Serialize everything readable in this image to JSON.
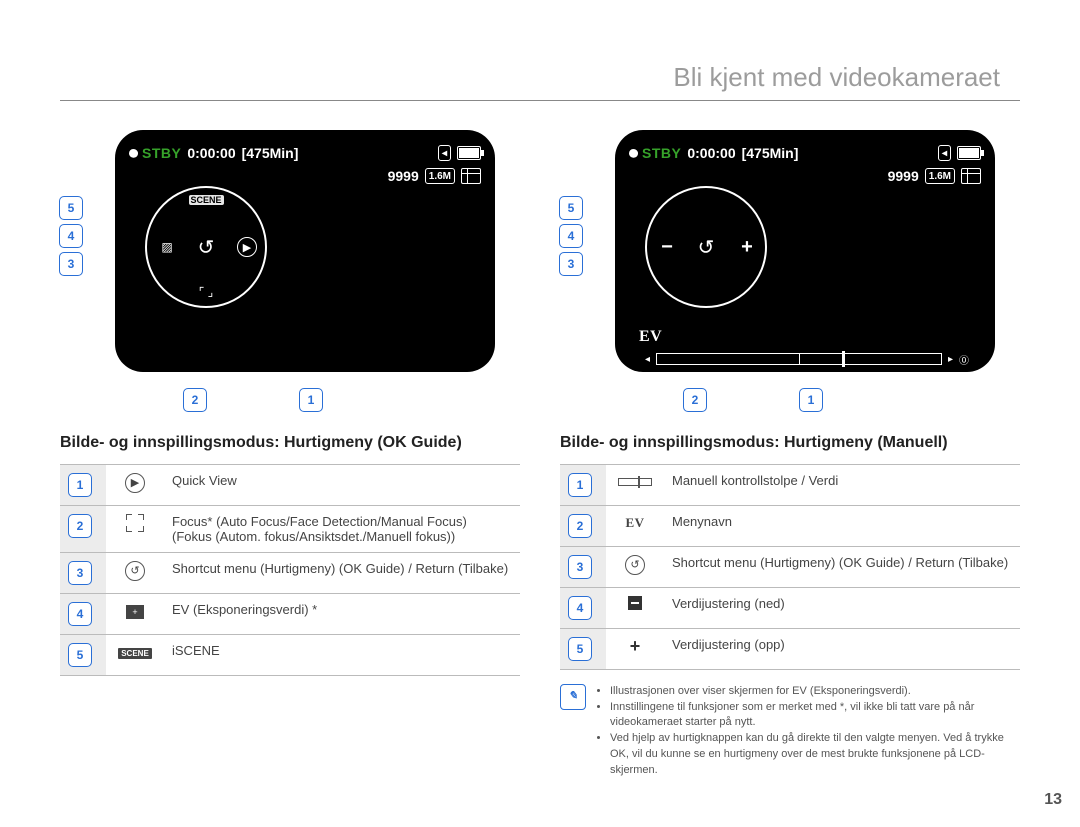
{
  "header": {
    "title": "Bli kjent med videokameraet"
  },
  "page_number": "13",
  "screen": {
    "stby": "STBY",
    "timecode": "0:00:00",
    "remaining": "[475Min]",
    "count": "9999",
    "megapixels": "1.6M",
    "ev_label": "EV"
  },
  "dial_ok_guide": {
    "top": "SCENE",
    "right_alt": "▶",
    "left": "✦",
    "bottom": "⌐ ¬",
    "center": "↺",
    "right_plus": "+",
    "left_minus": "−"
  },
  "left": {
    "heading": "Bilde- og innspillingsmodus: Hurtigmeny (OK Guide)",
    "items": [
      {
        "n": "1",
        "desc": "Quick View"
      },
      {
        "n": "2",
        "desc": "Focus* (Auto Focus/Face Detection/Manual Focus)\n(Fokus (Autom. fokus/Ansiktsdet./Manuell fokus))"
      },
      {
        "n": "3",
        "desc": "Shortcut menu (Hurtigmeny) (OK Guide) / Return (Tilbake)"
      },
      {
        "n": "4",
        "desc": "EV (Eksponeringsverdi) *"
      },
      {
        "n": "5",
        "desc": "iSCENE"
      }
    ]
  },
  "right": {
    "heading": "Bilde- og innspillingsmodus: Hurtigmeny (Manuell)",
    "items": [
      {
        "n": "1",
        "desc": "Manuell kontrollstolpe / Verdi"
      },
      {
        "n": "2",
        "desc": "Menynavn"
      },
      {
        "n": "3",
        "desc": "Shortcut menu (Hurtigmeny) (OK Guide) / Return (Tilbake)"
      },
      {
        "n": "4",
        "desc": "Verdijustering (ned)"
      },
      {
        "n": "5",
        "desc": "Verdijustering (opp)"
      }
    ]
  },
  "notes": [
    "Illustrasjonen over viser skjermen for EV (Eksponeringsverdi).",
    "Innstillingene til funksjoner som er merket med *, vil ikke bli tatt vare på når videokameraet starter på nytt.",
    "Ved hjelp av hurtigknappen kan du gå direkte til den valgte menyen. Ved å trykke OK, vil du kunne se en hurtigmeny over de mest brukte funksjonene på LCD-skjermen."
  ]
}
